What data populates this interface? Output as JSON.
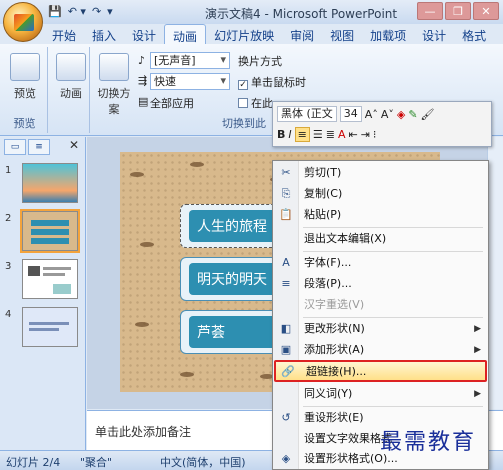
{
  "title_bar": {
    "window_title": "演示文稿4 - Microsoft PowerPoint",
    "quick_access": [
      "💾",
      "↶ ▾",
      "↷",
      "▾"
    ],
    "controls": [
      "—",
      "❐",
      "✕"
    ]
  },
  "tabs": [
    "开始",
    "插入",
    "设计",
    "动画",
    "幻灯片放映",
    "审阅",
    "视图",
    "加载项",
    "设计",
    "格式"
  ],
  "active_tab": "动画",
  "ribbon": {
    "preview_button": "预览",
    "preview_group": "预览",
    "animation_button": "动画",
    "switch_scheme_button": "切换方案",
    "sound_combo": "[无声音]",
    "speed_combo": "快速",
    "apply_all": "全部应用",
    "switch_mode_label": "换片方式",
    "on_click_label": "单击鼠标时",
    "auto_label": "在此",
    "switch_group": "切换到此"
  },
  "mini_toolbar": {
    "font": "黑体 (正文",
    "size": "34",
    "grow": "A˄",
    "shrink": "A˅",
    "bold": "B",
    "italic": "I"
  },
  "slide_pane": {
    "tabs": [
      "▭",
      "≡"
    ],
    "close": "✕",
    "numbers": [
      "1",
      "2",
      "3",
      "4"
    ]
  },
  "slide": {
    "boxes": [
      "人生的旅程",
      "明天的明天",
      "芦荟"
    ]
  },
  "context_menu": {
    "items": [
      {
        "icon": "✂",
        "label": "剪切(T)",
        "disabled": false,
        "submenu": false,
        "highlight": false
      },
      {
        "icon": "⎘",
        "label": "复制(C)",
        "disabled": false,
        "submenu": false,
        "highlight": false
      },
      {
        "icon": "📋",
        "label": "粘贴(P)",
        "disabled": false,
        "submenu": false,
        "highlight": false
      },
      {
        "icon": "",
        "label": "退出文本编辑(X)",
        "disabled": false,
        "submenu": false,
        "highlight": false
      },
      {
        "icon": "A",
        "label": "字体(F)...",
        "disabled": false,
        "submenu": false,
        "highlight": false
      },
      {
        "icon": "≡",
        "label": "段落(P)...",
        "disabled": false,
        "submenu": false,
        "highlight": false
      },
      {
        "icon": "",
        "label": "汉字重选(V)",
        "disabled": true,
        "submenu": false,
        "highlight": false
      },
      {
        "icon": "◧",
        "label": "更改形状(N)",
        "disabled": false,
        "submenu": true,
        "highlight": false
      },
      {
        "icon": "▣",
        "label": "添加形状(A)",
        "disabled": false,
        "submenu": true,
        "highlight": false
      },
      {
        "icon": "🔗",
        "label": "超链接(H)...",
        "disabled": false,
        "submenu": false,
        "highlight": true
      },
      {
        "icon": "",
        "label": "同义词(Y)",
        "disabled": false,
        "submenu": true,
        "highlight": false
      },
      {
        "icon": "↺",
        "label": "重设形状(E)",
        "disabled": false,
        "submenu": false,
        "highlight": false
      },
      {
        "icon": "",
        "label": "设置文字效果格式",
        "disabled": false,
        "submenu": false,
        "highlight": false
      },
      {
        "icon": "◈",
        "label": "设置形状格式(O)...",
        "disabled": false,
        "submenu": false,
        "highlight": false
      }
    ]
  },
  "notes": "单击此处添加备注",
  "status": {
    "slide_count": "幻灯片 2/4",
    "theme": "\"聚合\"",
    "language": "中文(简体，中国)"
  },
  "watermark": "最需教育"
}
